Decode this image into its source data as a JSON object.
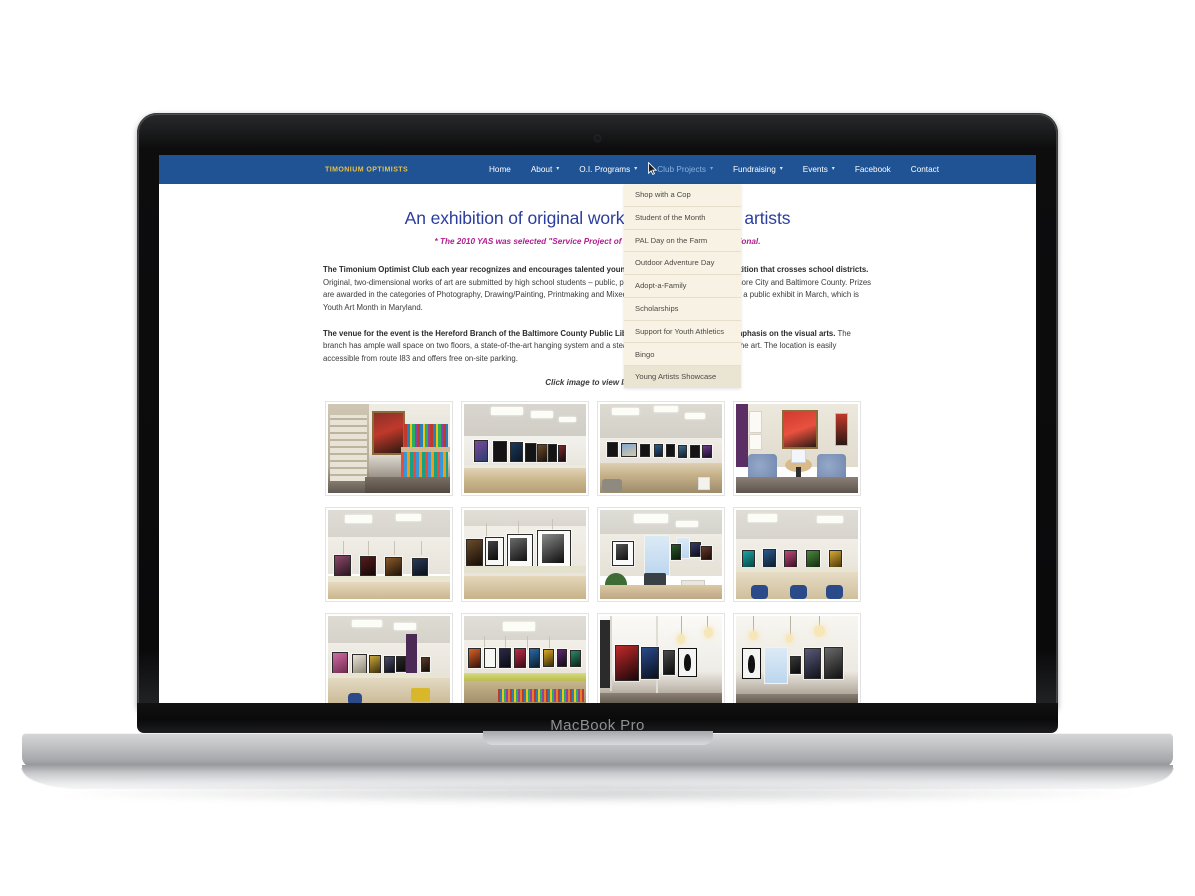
{
  "device": {
    "label": "MacBook Pro",
    "webcam_icon": "camera-dot-icon"
  },
  "site": {
    "brand": "TIMONIUM OPTIMISTS",
    "nav": [
      {
        "label": "Home",
        "has_caret": false,
        "active": false
      },
      {
        "label": "About",
        "has_caret": true,
        "active": false
      },
      {
        "label": "O.I. Programs",
        "has_caret": true,
        "active": false
      },
      {
        "label": "Club Projects",
        "has_caret": true,
        "active": true
      },
      {
        "label": "Fundraising",
        "has_caret": true,
        "active": false
      },
      {
        "label": "Events",
        "has_caret": true,
        "active": false
      },
      {
        "label": "Facebook",
        "has_caret": false,
        "active": false
      },
      {
        "label": "Contact",
        "has_caret": false,
        "active": false
      }
    ],
    "caret_glyph": "▾",
    "dropdown": {
      "parent": "Club Projects",
      "items": [
        {
          "label": "Shop with a Cop",
          "hovered": false
        },
        {
          "label": "Student of the Month",
          "hovered": false
        },
        {
          "label": "PAL Day on the Farm",
          "hovered": false
        },
        {
          "label": "Outdoor Adventure Day",
          "hovered": false
        },
        {
          "label": "Adopt-a-Family",
          "hovered": false
        },
        {
          "label": "Scholarships",
          "hovered": false
        },
        {
          "label": "Support for Youth Athletics",
          "hovered": false
        },
        {
          "label": "Bingo",
          "hovered": false
        },
        {
          "label": "Young Artists Showcase",
          "hovered": true
        }
      ]
    },
    "page": {
      "title": "An exhibition of original work by high school artists",
      "subtitle": "* The 2010 YAS was selected \"Service Project of the Year\" by Optimist International.",
      "paragraph1_bold": "The Timonium Optimist Club each year recognizes and encourages talented young artists with an exhibit/competition that crosses school districts.",
      "paragraph1_rest": " Original, two-dimensional works of art are submitted by high school students – public, private and independent – in Baltimore City and Baltimore County. Prizes are awarded in the categories of Photography, Drawing/Painting, Printmaking and Mixed Media. All entries are featured in a public exhibit in March, which is Youth Art Month in Maryland.",
      "paragraph2_bold": "The venue for the event is the Hereford Branch of the Baltimore County Public Library, which places a special emphasis on the visual arts.",
      "paragraph2_rest": " The branch has ample wall space on two floors, a state-of-the-art hanging system and a steady stream of patrons who enjoy the art. The location is easily accessible from route I83 and offers free on-site parking.",
      "click_note": "Click image to view larger..."
    },
    "gallery": {
      "caption_alt": "Young Artists Showcase exhibition photographs",
      "thumbnails": [
        {
          "id": "thumb-1",
          "scene": "library-stacks-portrait",
          "alt": "Framed boxer portrait on wall beside library magazine shelving"
        },
        {
          "id": "thumb-2",
          "scene": "long-wall-framed-row",
          "alt": "Row of framed artworks along a white library wall above study desks"
        },
        {
          "id": "thumb-3",
          "scene": "reading-room-wide",
          "alt": "Wide view of reading room with artwork hung above computer carrels"
        },
        {
          "id": "thumb-4",
          "scene": "lounge-chairs-red-art",
          "alt": "Two blue lounge chairs and round table beneath a red framed portrait"
        },
        {
          "id": "thumb-5",
          "scene": "four-frames-wall",
          "alt": "Four framed photographs spaced along a wall above a desk rail"
        },
        {
          "id": "thumb-6",
          "scene": "black-white-photos",
          "alt": "Close view of black and white framed photographs on hanging rail"
        },
        {
          "id": "thumb-7",
          "scene": "window-corner-office",
          "alt": "Corner with bright window, copier and framed artwork on walls"
        },
        {
          "id": "thumb-8",
          "scene": "carrels-colored-art",
          "alt": "Colorful framed prints above study carrels with blue chairs"
        },
        {
          "id": "thumb-9",
          "scene": "purple-column-hall",
          "alt": "Long hallway with framed art and a purple structural column"
        },
        {
          "id": "thumb-10",
          "scene": "green-counter-shelf",
          "alt": "Framed works above a green counter and low bookshelves"
        },
        {
          "id": "thumb-11",
          "scene": "white-corner-pendant",
          "alt": "White corner walls with framed art and pendant lighting"
        },
        {
          "id": "thumb-12",
          "scene": "silhouettes-window",
          "alt": "Silhouette artworks and framed pieces flanking a bright window"
        }
      ]
    }
  },
  "colors": {
    "nav_blue": "#1f5394",
    "brand_gold": "#e8c14a",
    "nav_active": "#8ab2e0",
    "title_blue": "#2b3d9e",
    "subtitle_magenta": "#b02090",
    "dropdown_bg": "#f7f2e4",
    "dropdown_hover_bg": "#eae4d3",
    "dropdown_text": "#4d4a46",
    "body_text": "#3b3b3b"
  }
}
